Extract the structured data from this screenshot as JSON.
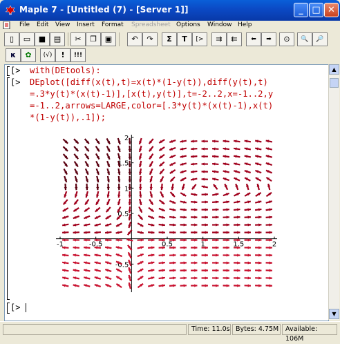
{
  "window": {
    "title": "Maple 7 - [Untitled (7) - [Server 1]]"
  },
  "menu": {
    "items": [
      "File",
      "Edit",
      "View",
      "Insert",
      "Format",
      "Spreadsheet",
      "Options",
      "Window",
      "Help"
    ],
    "disabled": [
      "Spreadsheet"
    ]
  },
  "toolbar1": {
    "buttons": [
      {
        "name": "new-file",
        "glyph": "▯"
      },
      {
        "name": "open",
        "glyph": "▭"
      },
      {
        "name": "save",
        "glyph": "■"
      },
      {
        "name": "print",
        "glyph": "▤"
      },
      {
        "name": "cut",
        "glyph": "✂"
      },
      {
        "name": "copy",
        "glyph": "❐"
      },
      {
        "name": "paste",
        "glyph": "▣"
      },
      {
        "name": "undo",
        "glyph": "↶"
      },
      {
        "name": "redo",
        "glyph": "↷"
      },
      {
        "name": "insert-maple-input",
        "glyph": "Σ"
      },
      {
        "name": "insert-text",
        "glyph": "T"
      },
      {
        "name": "insert-execution-group",
        "glyph": "[>"
      },
      {
        "name": "section",
        "glyph": "⇉"
      },
      {
        "name": "remove-section",
        "glyph": "⇇"
      },
      {
        "name": "back",
        "glyph": "⬅"
      },
      {
        "name": "forward",
        "glyph": "➡"
      },
      {
        "name": "stop",
        "glyph": "⊙"
      },
      {
        "name": "zoom-in",
        "glyph": "🔍"
      },
      {
        "name": "zoom-out",
        "glyph": "🔎"
      }
    ]
  },
  "toolbar2": {
    "buttons": [
      {
        "name": "math-mode",
        "glyph": "κ"
      },
      {
        "name": "execute-worksheet",
        "glyph": "✿"
      },
      {
        "name": "maple-text-toggle",
        "glyph": "(√)"
      },
      {
        "name": "execute",
        "glyph": "!"
      },
      {
        "name": "execute-all",
        "glyph": "!!!"
      }
    ]
  },
  "worksheet": {
    "prompt": "[>",
    "line1": "with(DEtools):",
    "line2": [
      "DEplot([diff(x(t),t)=x(t)*(1-y(t)),diff(y(t),t)",
      "=.3*y(t)*(x(t)-1)],[x(t),y(t)],t=-2..2,x=-1..2,y",
      "=-1..2,arrows=LARGE,color=[.3*y(t)*(x(t)-1),x(t)",
      "*(1-y(t)),.1]);"
    ],
    "empty_prompt": "[>"
  },
  "chart_data": {
    "type": "scatter",
    "kind": "direction field",
    "system": [
      "x' = x*(1-y)",
      "y' = 0.3*y*(x-1)"
    ],
    "xlim": [
      -1,
      2
    ],
    "ylim": [
      -1,
      2
    ],
    "xticks": [
      "-1",
      "-0.5",
      "0.5",
      "1",
      "1.5",
      "2"
    ],
    "yticks": [
      "2",
      "1.5",
      "1",
      "0.5",
      "-0.5"
    ],
    "grid_nx": 20,
    "grid_ny": 20,
    "colors": [
      "#a0001c",
      "#5a0010",
      "#c8102e"
    ]
  },
  "statusbar": {
    "time": "Time: 11.0s",
    "bytes": "Bytes: 4.75M",
    "available": "Available: 106M"
  },
  "colors": {
    "title_bg": "#0b49c4",
    "input_text": "#c00000"
  }
}
